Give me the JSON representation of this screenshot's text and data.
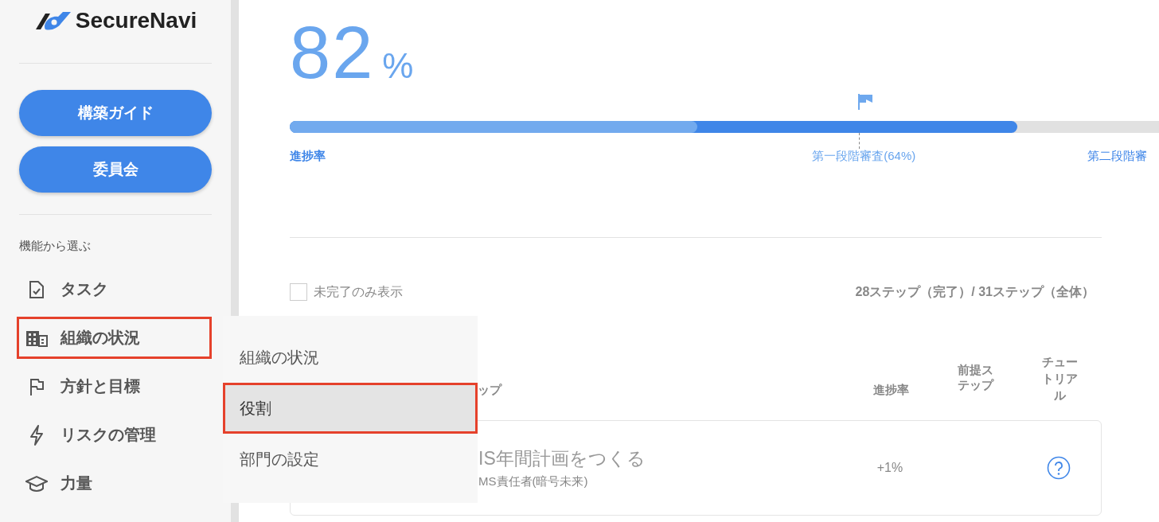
{
  "logo": {
    "text": "SecureNavi"
  },
  "sidebar": {
    "buttons": [
      "構築ガイド",
      "委員会"
    ],
    "section_label": "機能から選ぶ",
    "items": [
      {
        "kind": "task",
        "label": "タスク",
        "highlighted": false
      },
      {
        "kind": "organization",
        "label": "組織の状況",
        "highlighted": true
      },
      {
        "kind": "policy",
        "label": "方針と目標",
        "highlighted": false
      },
      {
        "kind": "risk",
        "label": "リスクの管理",
        "highlighted": false
      },
      {
        "kind": "competence",
        "label": "力量",
        "highlighted": false
      }
    ]
  },
  "progress": {
    "percent": "82",
    "unit": "%",
    "segments": [
      {
        "kind": "completed",
        "level": 0.469
      },
      {
        "kind": "total",
        "level": 0.837
      }
    ],
    "labels": [
      {
        "kind": "start",
        "text": "進捗率"
      },
      {
        "kind": "milestone",
        "text": "第一段階審査(64%)"
      },
      {
        "kind": "end",
        "text": "第二段階審"
      }
    ]
  },
  "filter": {
    "label": "未完了のみ表示",
    "checked": false
  },
  "step_count": "28ステップ（完了）/ 31ステップ（全体）",
  "table": {
    "columns": [
      "ップ",
      "進捗率",
      "前提ステップ",
      "チュートリアル"
    ],
    "rows": [
      {
        "title": "IS年間計画をつくる",
        "owner": "MS責任者(暗号未来)",
        "progress": "+1%",
        "tutorial": true
      }
    ]
  },
  "popup_menu": {
    "items": [
      {
        "label": "組織の状況",
        "selected": false
      },
      {
        "label": "役割",
        "selected": true
      },
      {
        "label": "部門の設定",
        "selected": false
      }
    ]
  }
}
